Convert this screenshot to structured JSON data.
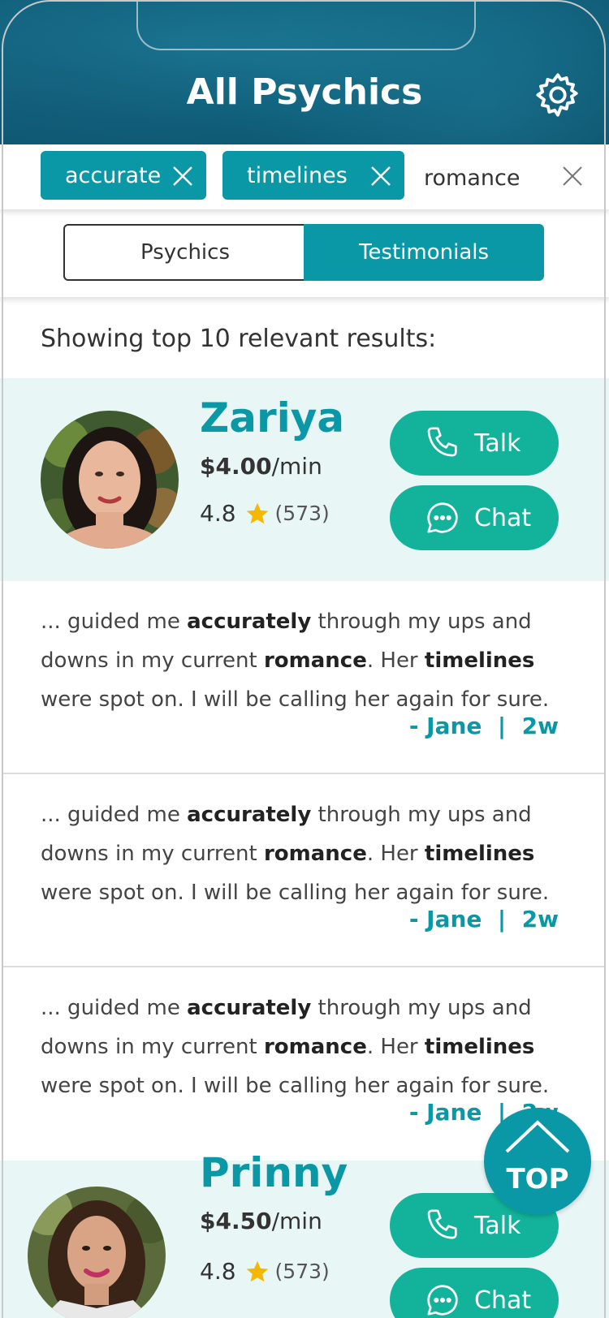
{
  "header": {
    "title": "All Psychics"
  },
  "search": {
    "chips": [
      {
        "label": "accurate"
      },
      {
        "label": "timelines"
      }
    ],
    "query": "romance"
  },
  "tabs": [
    {
      "label": "Psychics"
    },
    {
      "label": "Testimonials"
    }
  ],
  "active_tab": "Testimonials",
  "results": {
    "label": "Showing top 10 relevant results:"
  },
  "psychics": [
    {
      "name": "Zariya",
      "price": "$4.00",
      "price_unit": "/min",
      "rating": "4.8",
      "reviews": "(573)",
      "talk_label": "Talk",
      "chat_label": "Chat"
    },
    {
      "name": "Prinny",
      "price": "$4.50",
      "price_unit": "/min",
      "rating": "4.8",
      "reviews": "(573)",
      "talk_label": "Talk",
      "chat_label": "Chat"
    }
  ],
  "testimonials": [
    {
      "t1": "... guided me ",
      "k1": "accurately",
      "t2": " through my ups and downs in my current ",
      "k2": "romance",
      "t3": ".  Her ",
      "k3": "timelines",
      "t4": " were spot on. I will be calling her again for sure.",
      "byline": "- Jane  |  2w"
    },
    {
      "t1": "... guided me ",
      "k1": "accurately",
      "t2": " through my ups and downs in my current ",
      "k2": "romance",
      "t3": ".  Her ",
      "k3": "timelines",
      "t4": " were spot on. I will be calling her again for sure.",
      "byline": "- Jane  |  2w"
    },
    {
      "t1": "... guided me ",
      "k1": "accurately",
      "t2": " through my ups and downs in my current ",
      "k2": "romance",
      "t3": ".  Her ",
      "k3": "timelines",
      "t4": " were spot on. I will be calling her again for sure.",
      "byline": "- Jane  |  2w"
    }
  ],
  "top_button": {
    "label": "TOP"
  },
  "colors": {
    "accent": "#0a98a6",
    "button_green": "#12b39a",
    "star": "#f5b800",
    "card_bg": "#e9f6f6"
  }
}
